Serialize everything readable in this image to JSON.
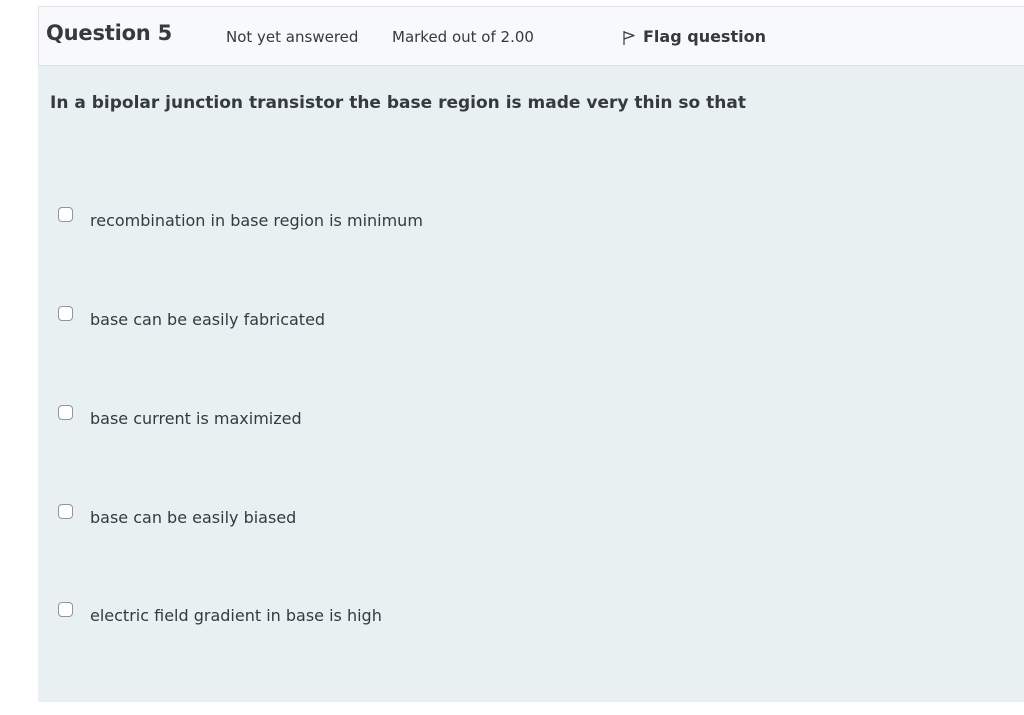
{
  "question": {
    "title": "Question 5",
    "state": "Not yet answered",
    "grade": "Marked out of 2.00",
    "flag_label": "Flag question",
    "text": "In a bipolar junction transistor the base region is made very thin so that"
  },
  "answers": [
    {
      "label": "recombination in base region is minimum",
      "checked": false
    },
    {
      "label": "base can be easily fabricated",
      "checked": false
    },
    {
      "label": "base current is maximized",
      "checked": false
    },
    {
      "label": "base can be easily biased",
      "checked": false
    },
    {
      "label": "electric field gradient in base is high",
      "checked": false
    }
  ],
  "icons": {
    "flag": "flag-outline-icon"
  }
}
